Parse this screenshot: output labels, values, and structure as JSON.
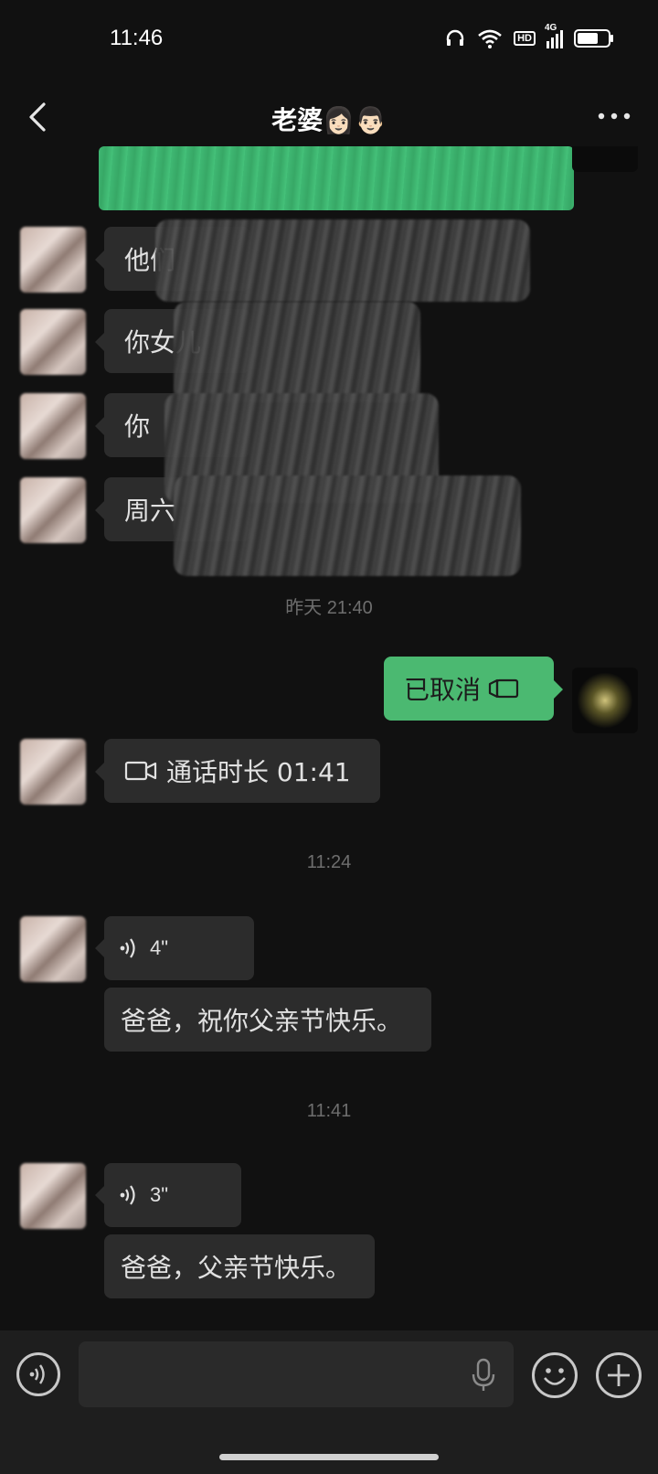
{
  "status_bar": {
    "time": "11:46",
    "network": "4G",
    "hd": "HD"
  },
  "header": {
    "title": "老婆👩🏻👨🏻"
  },
  "messages": [
    {
      "type": "text",
      "side": "left",
      "text": "他们"
    },
    {
      "type": "text",
      "side": "left",
      "text": "你女儿"
    },
    {
      "type": "text",
      "side": "left",
      "text": "你"
    },
    {
      "type": "text",
      "side": "left",
      "text": "周六"
    }
  ],
  "timestamps": {
    "t1": "昨天 21:40",
    "t2": "11:24",
    "t3": "11:41"
  },
  "call_cancelled": {
    "label": "已取消"
  },
  "call_duration": {
    "label": "通话时长 01:41"
  },
  "voice_1": {
    "duration": "4\"",
    "transcript": "爸爸，祝你父亲节快乐。"
  },
  "voice_2": {
    "duration": "3\"",
    "transcript": "爸爸，父亲节快乐。"
  },
  "input": {
    "placeholder": ""
  },
  "colors": {
    "accent_green": "#4bb971",
    "bubble_dark": "#2c2c2c",
    "background": "#111111"
  }
}
